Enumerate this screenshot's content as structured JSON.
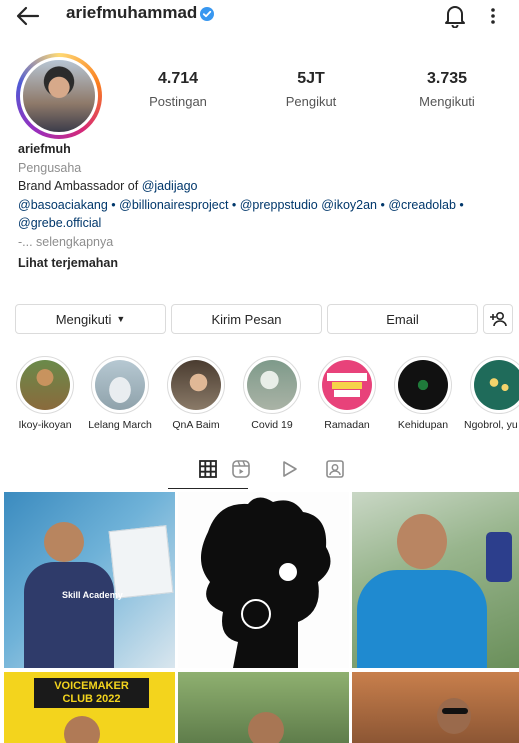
{
  "header": {
    "username": "ariefmuhammad",
    "icons": [
      "back-arrow-icon",
      "verified-badge-icon",
      "bell-icon",
      "more-vertical-icon"
    ]
  },
  "stats": [
    {
      "value": "4.714",
      "label": "Postingan"
    },
    {
      "value": "5JT",
      "label": "Pengikut"
    },
    {
      "value": "3.735",
      "label": "Mengikuti"
    }
  ],
  "bio": {
    "name": "ariefmuh",
    "category": "Pengusaha",
    "line1_prefix": "Brand Ambassador of ",
    "line1_link": "@jadijago",
    "mentions_line2": "@basoaciakang • @billionairesproject • @preppstudio @ikoy2an • @creadolab •",
    "mentions_line3": "@grebe.official",
    "more": "-... selengkapnya",
    "translate": "Lihat terjemahan"
  },
  "actions": {
    "following": "Mengikuti",
    "message": "Kirim Pesan",
    "email": "Email",
    "add_user_icon": "add-person-icon"
  },
  "highlights": [
    {
      "label": "Ikoy-ikoyan",
      "color": "#8a6a3c"
    },
    {
      "label": "Lelang March",
      "color": "#c9d4d8"
    },
    {
      "label": "QnA Baim",
      "color": "#6b5b4b"
    },
    {
      "label": "Covid 19",
      "color": "#9aa39a"
    },
    {
      "label": "Ramadan",
      "color": "#e8427a",
      "badge": "#RAMADAN EXTRA FAEDAH"
    },
    {
      "label": "Kehidupan",
      "color": "#111111"
    },
    {
      "label": "Ngobrol, yu",
      "color": "#1f6b5a"
    }
  ],
  "tabs": [
    "grid-icon",
    "reels-icon",
    "play-icon",
    "tagged-icon"
  ],
  "grid": {
    "post4_text": "VOICEMAKER CLUB 2022",
    "post1_text": "Skill Academy"
  },
  "colors": {
    "accent": "#3897f0",
    "link": "#00376b",
    "border": "#dbdbdb",
    "muted": "#8e8e8e"
  }
}
